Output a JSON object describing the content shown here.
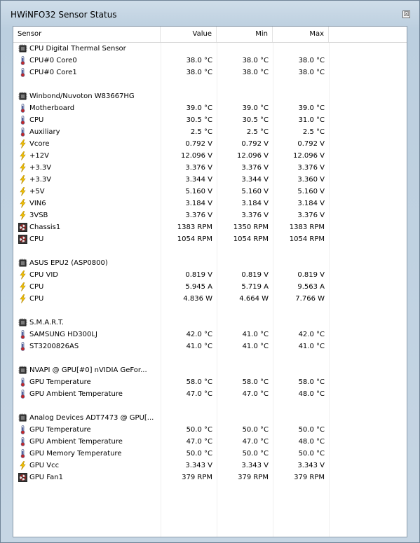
{
  "window": {
    "title": "HWiNFO32 Sensor Status",
    "close_glyph": "☒"
  },
  "columns": {
    "sensor": "Sensor",
    "value": "Value",
    "min": "Min",
    "max": "Max"
  },
  "rows": [
    {
      "type": "group",
      "icon": "chip-icon",
      "name": "CPU Digital Thermal Sensor"
    },
    {
      "type": "sensor",
      "icon": "thermometer-icon",
      "name": "CPU#0 Core0",
      "value": "38.0 °C",
      "min": "38.0 °C",
      "max": "38.0 °C"
    },
    {
      "type": "sensor",
      "icon": "thermometer-icon",
      "name": "CPU#0 Core1",
      "value": "38.0 °C",
      "min": "38.0 °C",
      "max": "38.0 °C"
    },
    {
      "type": "blank"
    },
    {
      "type": "group",
      "icon": "chip-icon",
      "name": "Winbond/Nuvoton W83667HG"
    },
    {
      "type": "sensor",
      "icon": "thermometer-icon",
      "name": "Motherboard",
      "value": "39.0 °C",
      "min": "39.0 °C",
      "max": "39.0 °C"
    },
    {
      "type": "sensor",
      "icon": "thermometer-icon",
      "name": "CPU",
      "value": "30.5 °C",
      "min": "30.5 °C",
      "max": "31.0 °C"
    },
    {
      "type": "sensor",
      "icon": "thermometer-icon",
      "name": "Auxiliary",
      "value": "2.5 °C",
      "min": "2.5 °C",
      "max": "2.5 °C"
    },
    {
      "type": "sensor",
      "icon": "lightning-icon",
      "name": "Vcore",
      "value": "0.792 V",
      "min": "0.792 V",
      "max": "0.792 V"
    },
    {
      "type": "sensor",
      "icon": "lightning-icon",
      "name": "+12V",
      "value": "12.096 V",
      "min": "12.096 V",
      "max": "12.096 V"
    },
    {
      "type": "sensor",
      "icon": "lightning-icon",
      "name": "+3.3V",
      "value": "3.376 V",
      "min": "3.376 V",
      "max": "3.376 V"
    },
    {
      "type": "sensor",
      "icon": "lightning-icon",
      "name": "+3.3V",
      "value": "3.344 V",
      "min": "3.344 V",
      "max": "3.360 V"
    },
    {
      "type": "sensor",
      "icon": "lightning-icon",
      "name": "+5V",
      "value": "5.160 V",
      "min": "5.160 V",
      "max": "5.160 V"
    },
    {
      "type": "sensor",
      "icon": "lightning-icon",
      "name": "VIN6",
      "value": "3.184 V",
      "min": "3.184 V",
      "max": "3.184 V"
    },
    {
      "type": "sensor",
      "icon": "lightning-icon",
      "name": "3VSB",
      "value": "3.376 V",
      "min": "3.376 V",
      "max": "3.376 V"
    },
    {
      "type": "sensor",
      "icon": "fan-icon",
      "name": "Chassis1",
      "value": "1383 RPM",
      "min": "1350 RPM",
      "max": "1383 RPM"
    },
    {
      "type": "sensor",
      "icon": "fan-icon",
      "name": "CPU",
      "value": "1054 RPM",
      "min": "1054 RPM",
      "max": "1054 RPM"
    },
    {
      "type": "blank"
    },
    {
      "type": "group",
      "icon": "chip-icon",
      "name": "ASUS EPU2 (ASP0800)"
    },
    {
      "type": "sensor",
      "icon": "lightning-icon",
      "name": "CPU VID",
      "value": "0.819 V",
      "min": "0.819 V",
      "max": "0.819 V"
    },
    {
      "type": "sensor",
      "icon": "lightning-icon",
      "name": "CPU",
      "value": "5.945 A",
      "min": "5.719 A",
      "max": "9.563 A"
    },
    {
      "type": "sensor",
      "icon": "lightning-icon",
      "name": "CPU",
      "value": "4.836 W",
      "min": "4.664 W",
      "max": "7.766 W"
    },
    {
      "type": "blank"
    },
    {
      "type": "group",
      "icon": "chip-icon",
      "name": "S.M.A.R.T."
    },
    {
      "type": "sensor",
      "icon": "thermometer-icon",
      "name": "SAMSUNG HD300LJ",
      "value": "42.0 °C",
      "min": "41.0 °C",
      "max": "42.0 °C"
    },
    {
      "type": "sensor",
      "icon": "thermometer-icon",
      "name": "ST3200826AS",
      "value": "41.0 °C",
      "min": "41.0 °C",
      "max": "41.0 °C"
    },
    {
      "type": "blank"
    },
    {
      "type": "group",
      "icon": "chip-icon",
      "name": "NVAPI @ GPU[#0] nVIDIA GeFor..."
    },
    {
      "type": "sensor",
      "icon": "thermometer-icon",
      "name": "GPU Temperature",
      "value": "58.0 °C",
      "min": "58.0 °C",
      "max": "58.0 °C"
    },
    {
      "type": "sensor",
      "icon": "thermometer-icon",
      "name": "GPU Ambient Temperature",
      "value": "47.0 °C",
      "min": "47.0 °C",
      "max": "48.0 °C"
    },
    {
      "type": "blank"
    },
    {
      "type": "group",
      "icon": "chip-icon",
      "name": "Analog Devices ADT7473 @ GPU[..."
    },
    {
      "type": "sensor",
      "icon": "thermometer-icon",
      "name": "GPU Temperature",
      "value": "50.0 °C",
      "min": "50.0 °C",
      "max": "50.0 °C"
    },
    {
      "type": "sensor",
      "icon": "thermometer-icon",
      "name": "GPU Ambient Temperature",
      "value": "47.0 °C",
      "min": "47.0 °C",
      "max": "48.0 °C"
    },
    {
      "type": "sensor",
      "icon": "thermometer-icon",
      "name": "GPU Memory Temperature",
      "value": "50.0 °C",
      "min": "50.0 °C",
      "max": "50.0 °C"
    },
    {
      "type": "sensor",
      "icon": "lightning-icon",
      "name": "GPU Vcc",
      "value": "3.343 V",
      "min": "3.343 V",
      "max": "3.343 V"
    },
    {
      "type": "sensor",
      "icon": "fan-icon",
      "name": "GPU Fan1",
      "value": "379 RPM",
      "min": "379 RPM",
      "max": "379 RPM"
    }
  ]
}
